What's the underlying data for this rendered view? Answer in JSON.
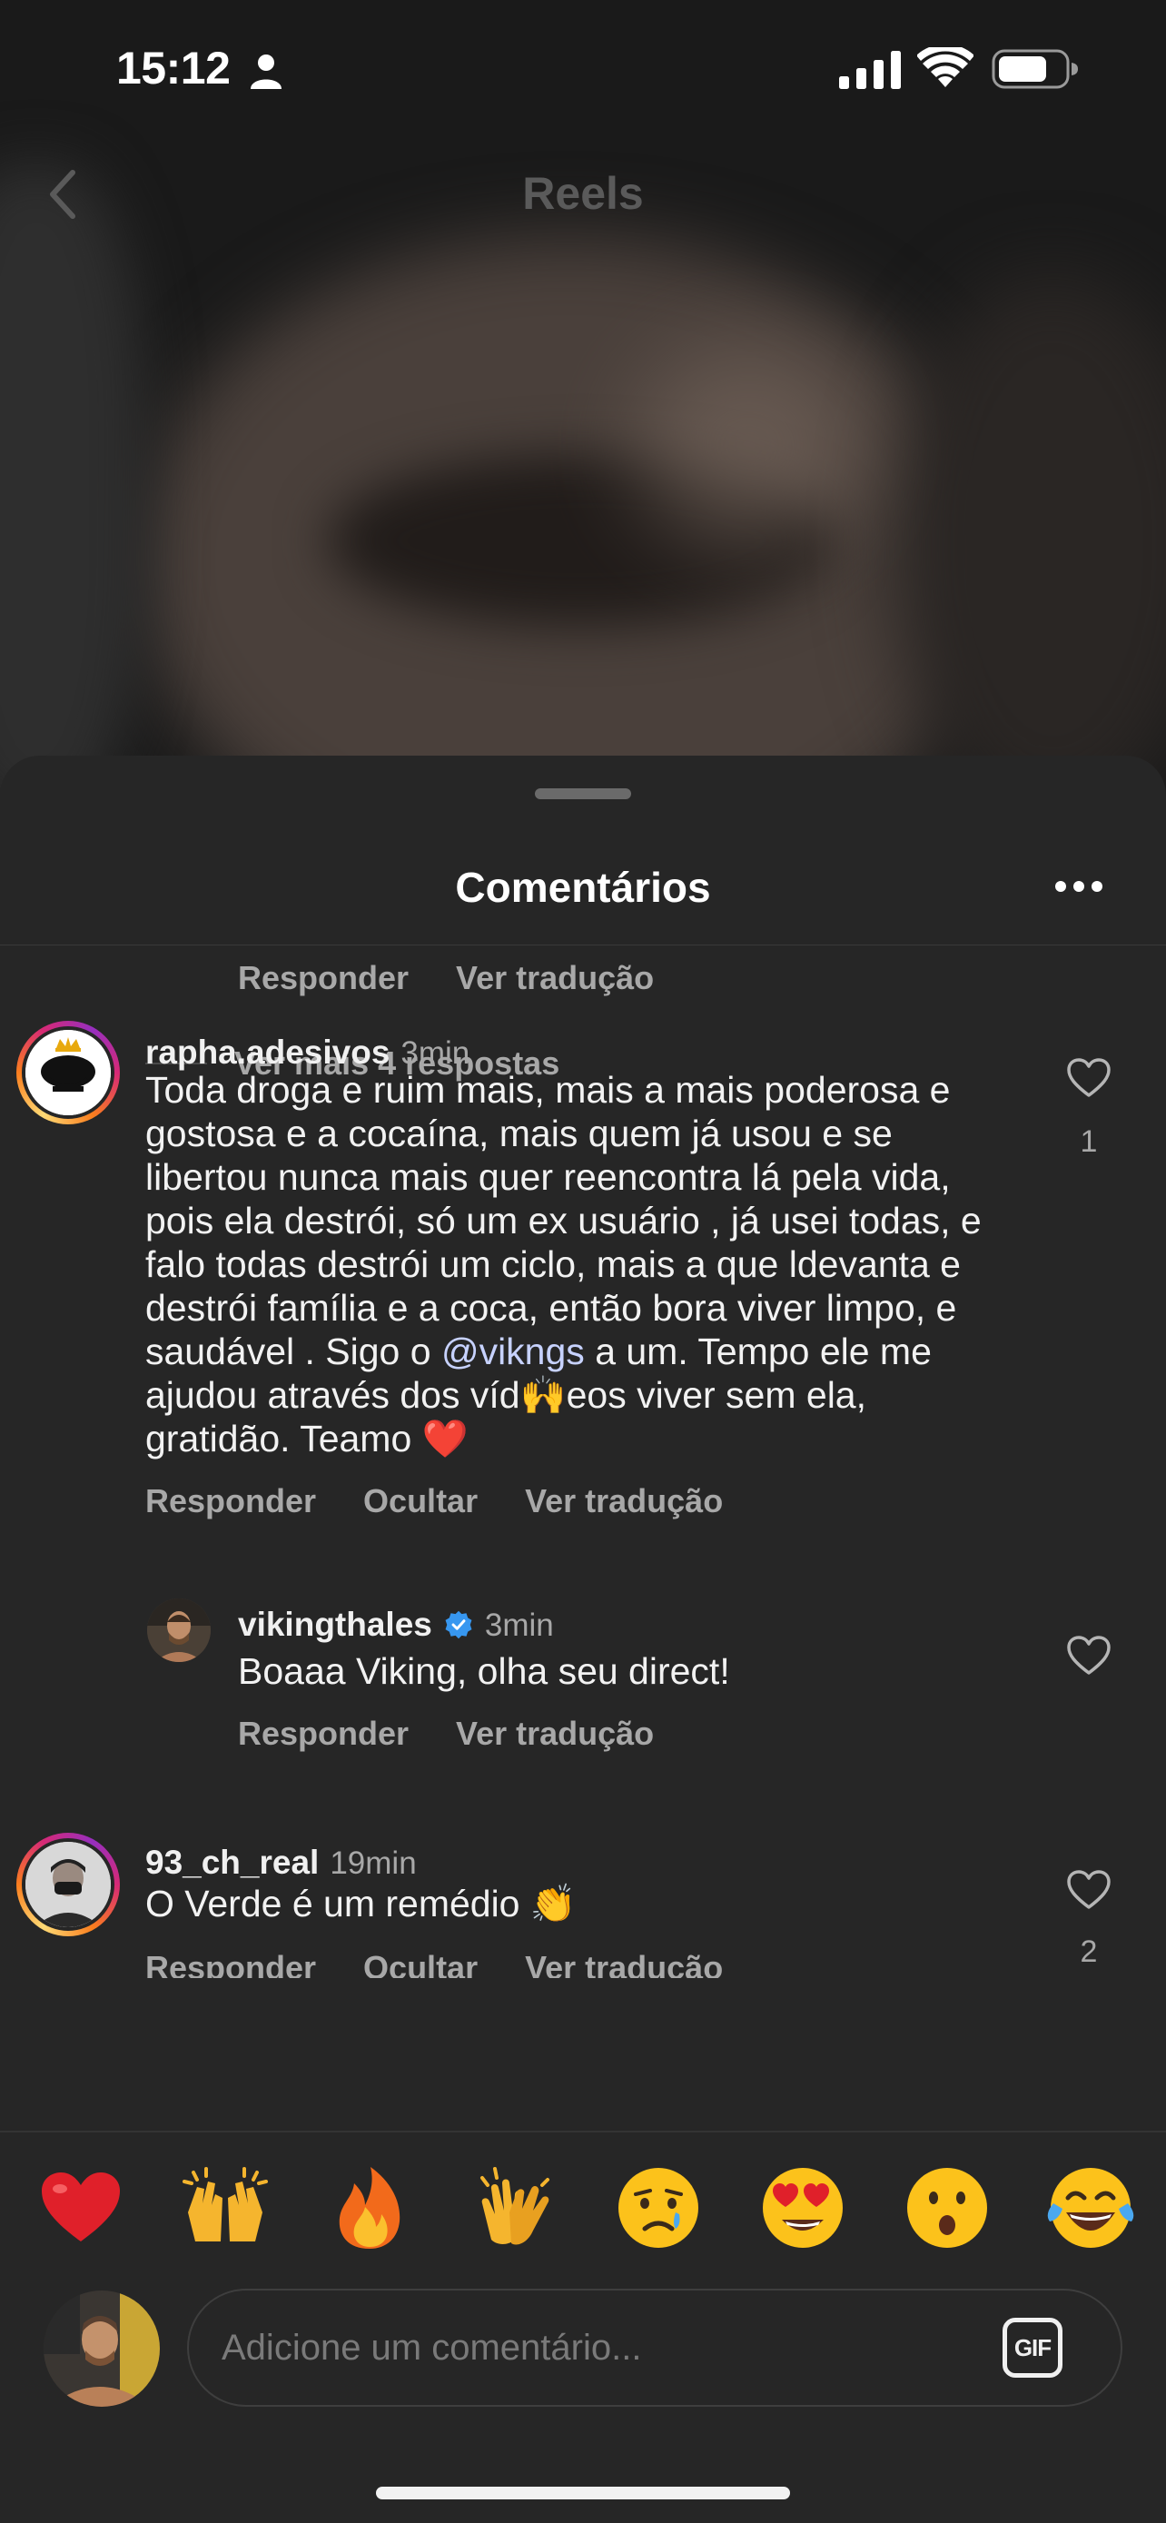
{
  "status_bar": {
    "time": "15:12"
  },
  "nav": {
    "title": "Reels"
  },
  "sheet": {
    "title": "Comentários"
  },
  "labels": {
    "reply": "Responder",
    "hide": "Ocultar",
    "translate": "Ver tradução"
  },
  "thread": {
    "more_replies": "Ver mais 4 respostas"
  },
  "comments": [
    {
      "username": "rapha.adesivos",
      "time": "3min",
      "text_before_mention": "Toda droga e ruim mais, mais a mais poderosa e gostosa e a cocaína, mais quem já usou e se libertou nunca mais quer reencontra lá pela vida, pois ela destrói, só um ex usuário , já usei todas, e falo  todas destrói um ciclo, mais a que ldevanta e destrói família e a coca, então bora viver limpo, e saudável . Sigo o ",
      "mention": "@vikngs",
      "text_after_mention": " a um. Tempo ele me ajudou através dos víd🙌eos viver sem ela, gratidão. Teamo ❤️",
      "likes": "1"
    },
    {
      "username": "vikingthales",
      "verified": true,
      "time": "3min",
      "text": "Boaaa Viking, olha seu direct!"
    },
    {
      "username": "93_ch_real",
      "time": "19min",
      "text": "O Verde é um remédio 👏",
      "likes": "2"
    }
  ],
  "emoji_reactions": [
    "red-heart",
    "raising-hands",
    "fire",
    "clapping-hands",
    "crying-face",
    "heart-eyes",
    "surprised-face",
    "tears-of-joy"
  ],
  "composer": {
    "placeholder": "Adicione um comentário...",
    "gif_label": "GIF"
  },
  "colors": {
    "sheet_bg": "#262626",
    "secondary_text": "#a8a8a8",
    "mention": "#c7d2fe",
    "verified": "#3797f0"
  }
}
